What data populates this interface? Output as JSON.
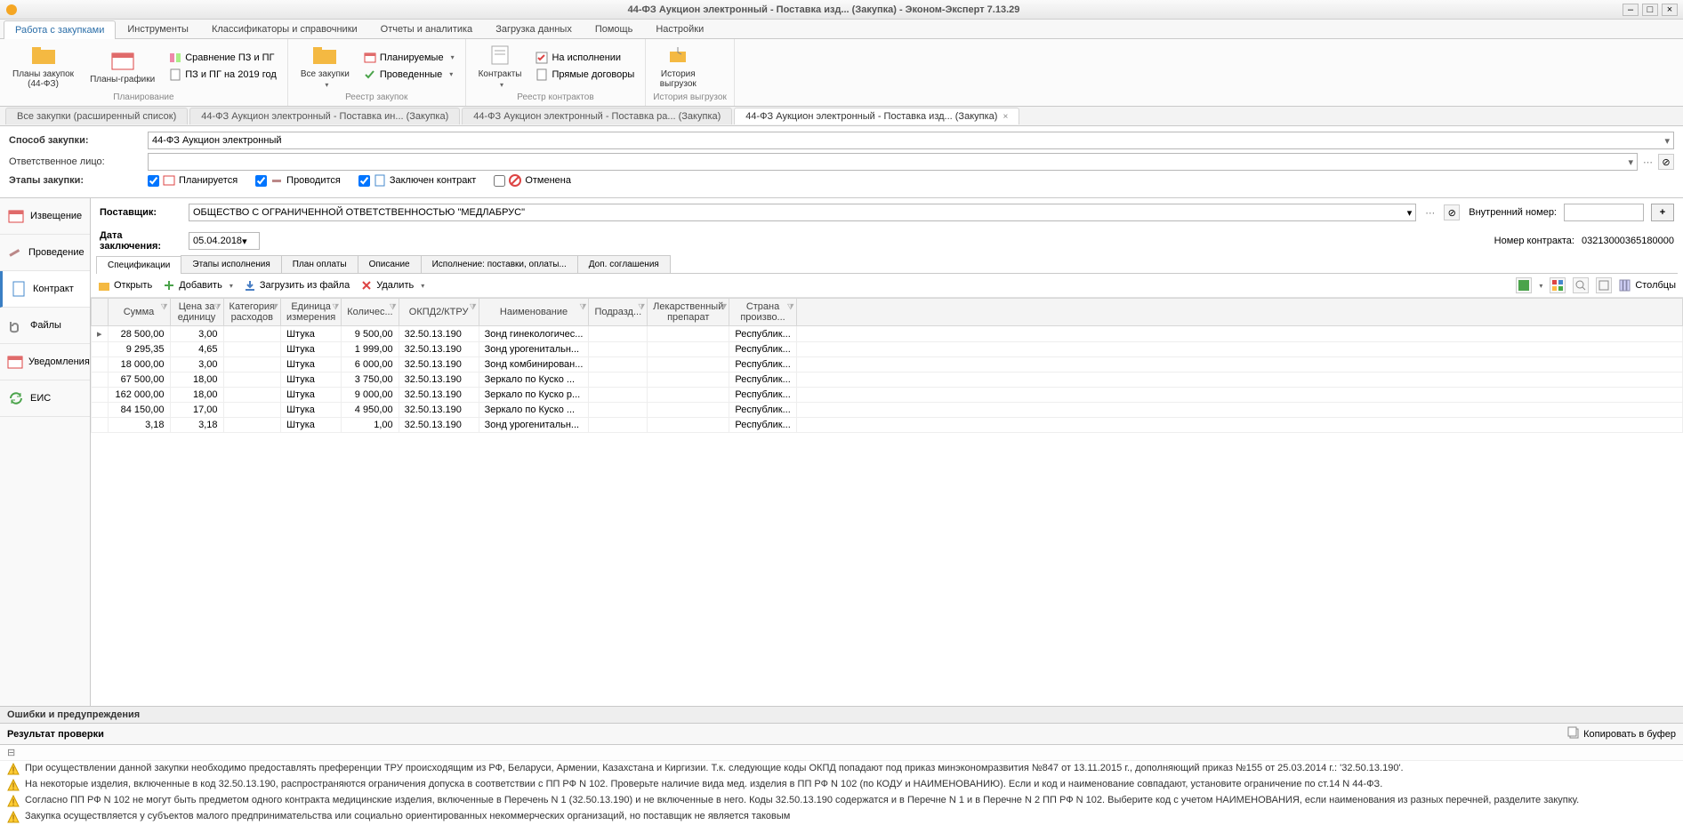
{
  "window_title": "44-ФЗ Аукцион электронный - Поставка изд... (Закупка) - Эконом-Эксперт 7.13.29",
  "menu_tabs": [
    "Работа с закупками",
    "Инструменты",
    "Классификаторы и справочники",
    "Отчеты и аналитика",
    "Загрузка данных",
    "Помощь",
    "Настройки"
  ],
  "ribbon": {
    "group_planning_label": "Планирование",
    "plans_label": "Планы закупок\n(44-ФЗ)",
    "plans_schedules_label": "Планы-графики",
    "compare_label": "Сравнение ПЗ и ПГ",
    "pz_pg_2019_label": "ПЗ и ПГ на 2019 год",
    "group_registry_label": "Реестр закупок",
    "all_purchases_label": "Все закупки",
    "planned_label": "Планируемые",
    "conducted_label": "Проведенные",
    "group_contracts_label": "Реестр контрактов",
    "contracts_label": "Контракты",
    "on_exec_label": "На исполнении",
    "direct_label": "Прямые договоры",
    "group_history_label": "История выгрузок",
    "history_label": "История\nвыгрузок"
  },
  "doc_tabs": [
    "Все закупки (расширенный список)",
    "44-ФЗ Аукцион электронный - Поставка  ин... (Закупка)",
    "44-ФЗ Аукцион электронный - Поставка  ра... (Закупка)",
    "44-ФЗ Аукцион электронный - Поставка изд... (Закупка)"
  ],
  "form": {
    "method_label": "Способ закупки:",
    "method_value": "44-ФЗ Аукцион электронный",
    "responsible_label": "Ответственное лицо:",
    "stages_label": "Этапы закупки:",
    "stage_planning": "Планируется",
    "stage_conducted": "Проводится",
    "stage_contract": "Заключен контракт",
    "stage_cancelled": "Отменена"
  },
  "leftnav": [
    "Извещение",
    "Проведение",
    "Контракт",
    "Файлы",
    "Уведомления",
    "ЕИС"
  ],
  "contract": {
    "supplier_label": "Поставщик:",
    "supplier_value": "ОБЩЕСТВО С ОГРАНИЧЕННОЙ ОТВЕТСТВЕННОСТЬЮ \"МЕДЛАБРУС\"",
    "date_label": "Дата заключения:",
    "date_value": "05.04.2018",
    "internal_num_label": "Внутренний номер:",
    "contract_num_label": "Номер контракта:",
    "contract_num_value": "03213000365180000"
  },
  "inner_tabs": [
    "Спецификации",
    "Этапы исполнения",
    "План оплаты",
    "Описание",
    "Исполнение: поставки, оплаты...",
    "Доп. соглашения"
  ],
  "toolbar": {
    "open": "Открыть",
    "add": "Добавить",
    "load": "Загрузить из файла",
    "delete": "Удалить",
    "columns": "Столбцы"
  },
  "grid": {
    "columns": [
      "Сумма",
      "Цена за единицу",
      "Категория расходов",
      "Единица измерения",
      "Количес...",
      "ОКПД2/КТРУ",
      "Наименование",
      "Подразд...",
      "Лекарственный препарат",
      "Страна произво..."
    ],
    "rows": [
      {
        "sum": "28 500,00",
        "price": "3,00",
        "cat": "",
        "unit": "Штука",
        "qty": "9 500,00",
        "okpd": "32.50.13.190",
        "name": "Зонд гинекологичес...",
        "dep": "",
        "med": "",
        "country": "Республик..."
      },
      {
        "sum": "9 295,35",
        "price": "4,65",
        "cat": "",
        "unit": "Штука",
        "qty": "1 999,00",
        "okpd": "32.50.13.190",
        "name": "Зонд урогенитальн...",
        "dep": "",
        "med": "",
        "country": "Республик..."
      },
      {
        "sum": "18 000,00",
        "price": "3,00",
        "cat": "",
        "unit": "Штука",
        "qty": "6 000,00",
        "okpd": "32.50.13.190",
        "name": "Зонд комбинирован...",
        "dep": "",
        "med": "",
        "country": "Республик..."
      },
      {
        "sum": "67 500,00",
        "price": "18,00",
        "cat": "",
        "unit": "Штука",
        "qty": "3 750,00",
        "okpd": "32.50.13.190",
        "name": "Зеркало  по Куско ...",
        "dep": "",
        "med": "",
        "country": "Республик..."
      },
      {
        "sum": "162 000,00",
        "price": "18,00",
        "cat": "",
        "unit": "Штука",
        "qty": "9 000,00",
        "okpd": "32.50.13.190",
        "name": "Зеркало  по Куско р...",
        "dep": "",
        "med": "",
        "country": "Республик..."
      },
      {
        "sum": "84 150,00",
        "price": "17,00",
        "cat": "",
        "unit": "Штука",
        "qty": "4 950,00",
        "okpd": "32.50.13.190",
        "name": "Зеркало  по Куско ...",
        "dep": "",
        "med": "",
        "country": "Республик..."
      },
      {
        "sum": "3,18",
        "price": "3,18",
        "cat": "",
        "unit": "Штука",
        "qty": "1,00",
        "okpd": "32.50.13.190",
        "name": "Зонд урогенитальн...",
        "dep": "",
        "med": "",
        "country": "Республик..."
      }
    ]
  },
  "errors": {
    "title": "Ошибки и предупреждения",
    "results_label": "Результат проверки",
    "copy_label": "Копировать в буфер",
    "warnings": [
      "При осуществлении данной закупки необходимо предоставлять преференции ТРУ происходящим из РФ, Беларуси, Армении, Казахстана и Киргизии. Т.к. следующие коды ОКПД попадают под приказ минэкономразвития №847 от 13.11.2015 г., дополняющий приказ №155 от 25.03.2014 г.: '32.50.13.190'.",
      "На некоторые изделия, включенные в код 32.50.13.190, распространяются ограничения допуска в соответствии с ПП РФ N 102. Проверьте наличие вида мед. изделия в ПП РФ N 102 (по КОДУ и НАИМЕНОВАНИЮ). Если и код и наименование совпадают, установите ограничение по ст.14 N 44-ФЗ.",
      "Согласно ПП РФ N 102 не могут быть предметом одного контракта медицинские изделия, включенные в Перечень N 1 (32.50.13.190) и не включенные в него. Коды 32.50.13.190 содержатся и в Перечне N 1 и в Перечне N 2 ПП РФ N 102. Выберите код с учетом НАИМЕНОВАНИЯ, если наименования из разных перечней, разделите закупку.",
      "Закупка осуществляется у субъектов малого предпринимательства или социально ориентированных некоммерческих организаций, но поставщик не является таковым"
    ]
  }
}
